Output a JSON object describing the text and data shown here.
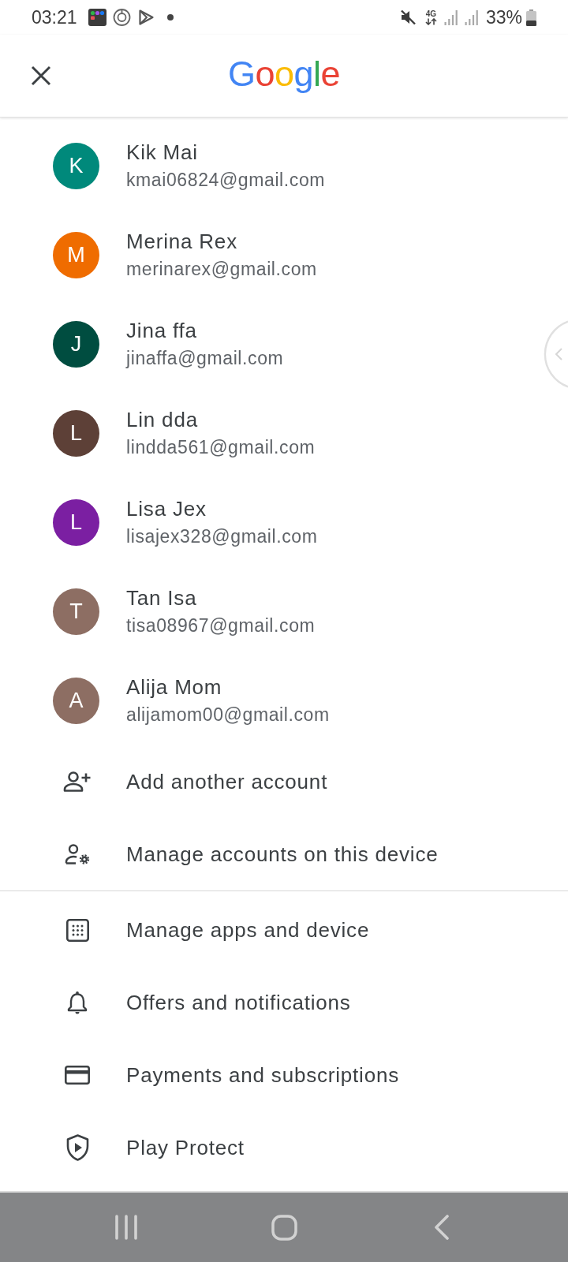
{
  "status_bar": {
    "time": "03:21",
    "network": "4G",
    "battery": "33%"
  },
  "header": {
    "logo": "Google"
  },
  "accounts": [
    {
      "initial": "K",
      "name": "Kik Mai",
      "email": "kmai06824@gmail.com",
      "color": "#00897b"
    },
    {
      "initial": "M",
      "name": "Merina Rex",
      "email": "merinarex@gmail.com",
      "color": "#ef6c00"
    },
    {
      "initial": "J",
      "name": "Jina ffa",
      "email": "jinaffa@gmail.com",
      "color": "#004d40"
    },
    {
      "initial": "L",
      "name": "Lin dda",
      "email": "lindda561@gmail.com",
      "color": "#5d4037"
    },
    {
      "initial": "L",
      "name": "Lisa Jex",
      "email": "lisajex328@gmail.com",
      "color": "#7b1fa2"
    },
    {
      "initial": "T",
      "name": "Tan Isa",
      "email": "tisa08967@gmail.com",
      "color": "#8d6e63"
    },
    {
      "initial": "A",
      "name": "Alija Mom",
      "email": "alijamom00@gmail.com",
      "color": "#8d6e63"
    }
  ],
  "account_actions": [
    "Add another account",
    "Manage accounts on this device"
  ],
  "menu": [
    "Manage apps and device",
    "Offers and notifications",
    "Payments and subscriptions",
    "Play Protect"
  ]
}
